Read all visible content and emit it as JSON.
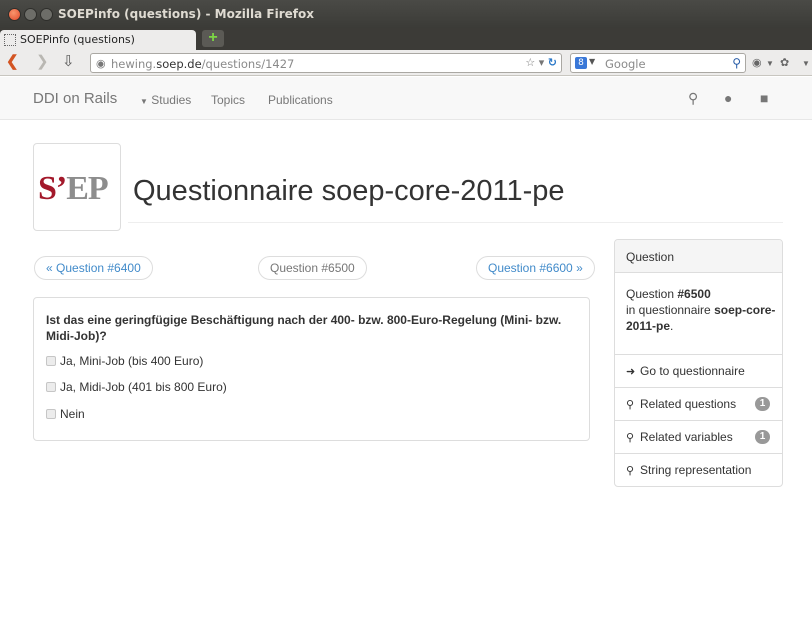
{
  "window": {
    "title": "SOEPinfo (questions) - Mozilla Firefox",
    "tab_title": "SOEPinfo (questions)",
    "new_tab_label": "+"
  },
  "browser": {
    "url_prefix": "hewing.",
    "url_host": "soep.de",
    "url_path": "/questions/1427",
    "search_placeholder": "Google",
    "icons": [
      "back-arrow-icon",
      "forward-arrow-icon",
      "download-icon",
      "globe-icon",
      "star-icon",
      "reload-icon",
      "search-engine-icon",
      "magnifier-icon",
      "addon-icon"
    ]
  },
  "navbar": {
    "brand": "DDI on Rails",
    "links": {
      "studies": "Studies",
      "topics": "Topics",
      "publications": "Publications"
    }
  },
  "header": {
    "logo_part1": "S’",
    "logo_part2": "EP",
    "title": "Questionnaire soep-core-2011-pe"
  },
  "pager": {
    "prev": "« Question #6400",
    "current": "Question #6500",
    "next": "Question #6600 »"
  },
  "question": {
    "text": "Ist das eine geringfügige Beschäftigung nach der 400- bzw. 800-Euro-Regelung (Mini- bzw. Midi-Job)?",
    "options": [
      "Ja, Mini-Job (bis 400 Euro)",
      "Ja, Midi-Job (401 bis 800 Euro)",
      "Nein"
    ]
  },
  "sidebar": {
    "heading": "Question",
    "info_prefix": "Question ",
    "question_number": "#6500",
    "info_mid": "in questionnaire ",
    "questionnaire": "soep-core-2011-pe",
    "info_suffix": ".",
    "items": [
      {
        "label": "Go to questionnaire",
        "icon": "arrow-right-icon"
      },
      {
        "label": "Related questions",
        "icon": "zoom-icon",
        "badge": "1"
      },
      {
        "label": "Related variables",
        "icon": "zoom-icon",
        "badge": "1"
      },
      {
        "label": "String representation",
        "icon": "zoom-icon"
      }
    ]
  }
}
